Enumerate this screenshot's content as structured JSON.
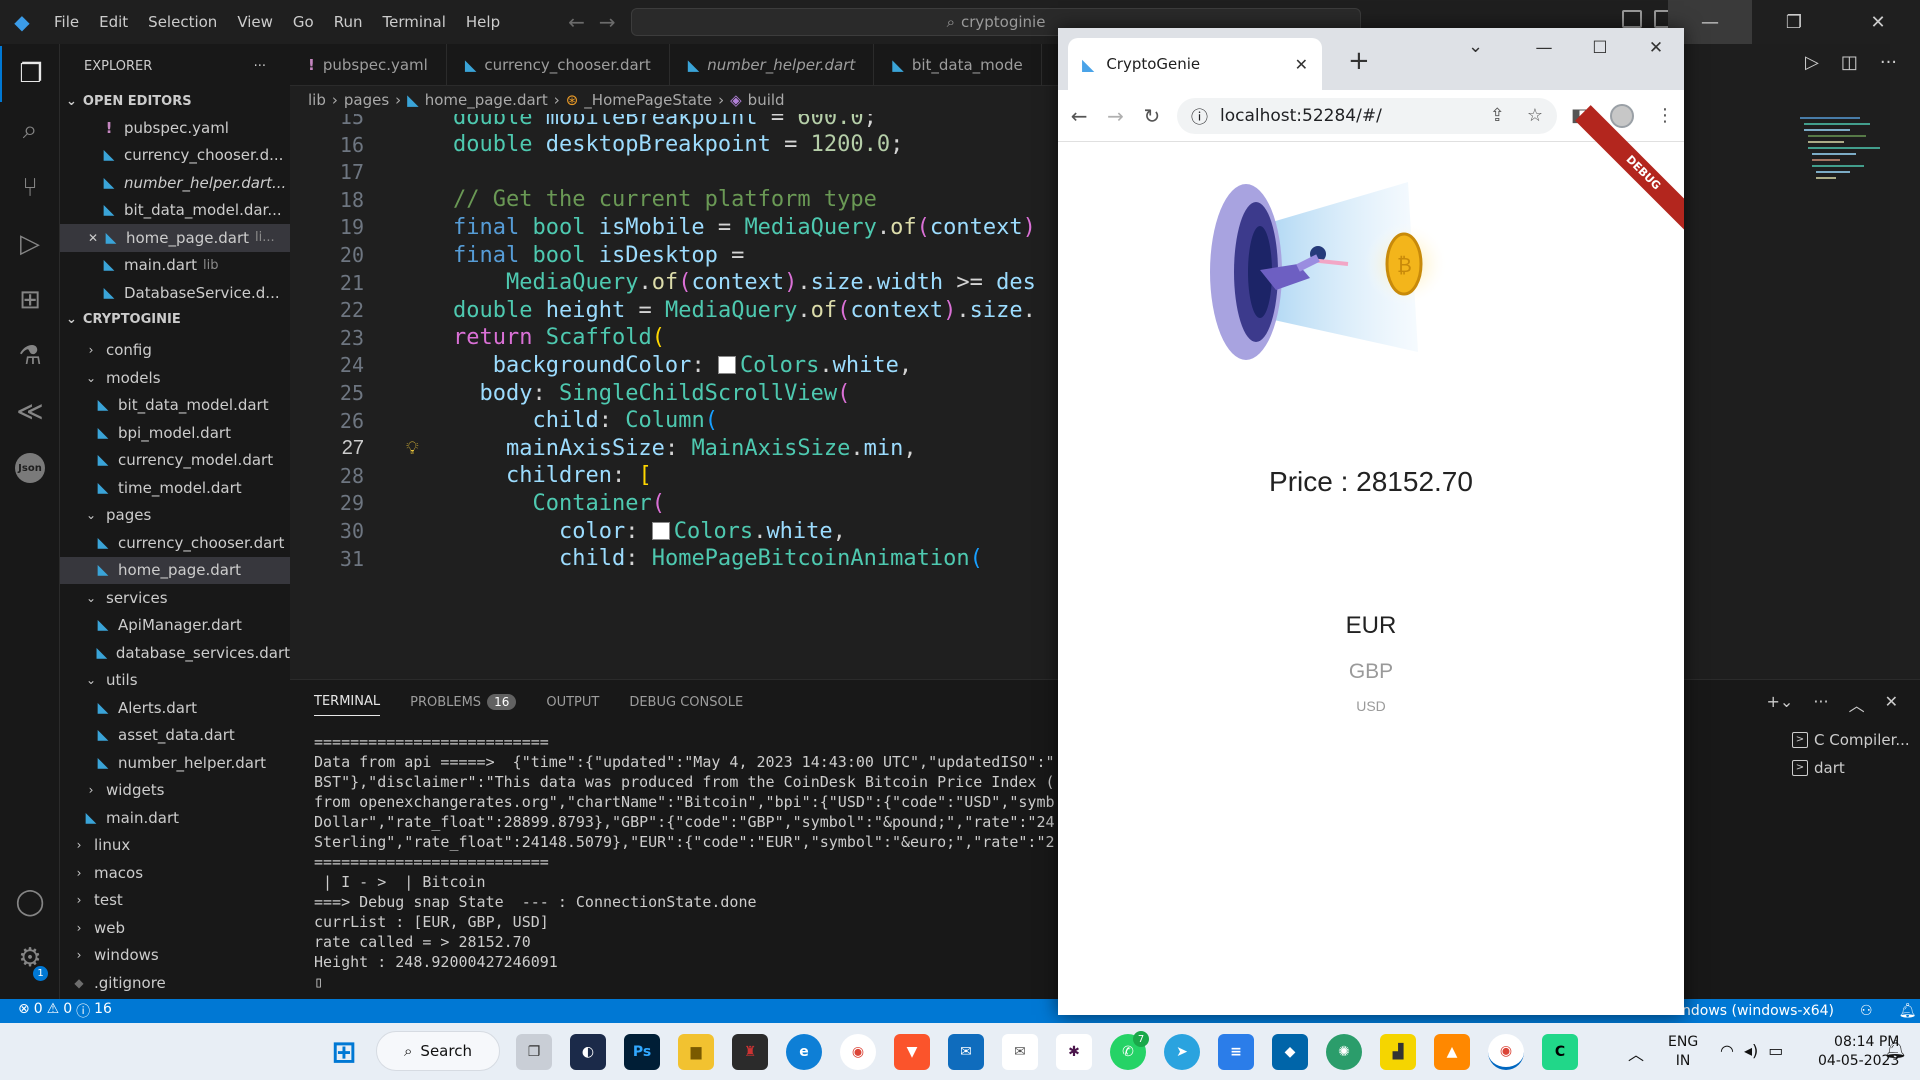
{
  "window": {
    "menu": [
      "File",
      "Edit",
      "Selection",
      "View",
      "Go",
      "Run",
      "Terminal",
      "Help"
    ],
    "search_text": "cryptoginie"
  },
  "sidebar": {
    "header": "EXPLORER",
    "more": "···",
    "open_editors_title": "OPEN EDITORS",
    "open_editors": [
      {
        "name": "pubspec.yaml",
        "kind": "yaml",
        "extra": ""
      },
      {
        "name": "currency_chooser.d...",
        "kind": "dart",
        "extra": ""
      },
      {
        "name": "number_helper.dart...",
        "kind": "dart",
        "extra": ""
      },
      {
        "name": "bit_data_model.dar...",
        "kind": "dart",
        "extra": ""
      },
      {
        "name": "home_page.dart",
        "kind": "dart",
        "extra": "li..."
      },
      {
        "name": "main.dart",
        "kind": "dart",
        "extra": "lib"
      },
      {
        "name": "DatabaseService.d...",
        "kind": "dart",
        "extra": ""
      }
    ],
    "project_title": "CRYPTOGINIE",
    "tree": [
      {
        "label": "config",
        "type": "folder",
        "open": false,
        "depth": 1
      },
      {
        "label": "models",
        "type": "folder",
        "open": true,
        "depth": 1
      },
      {
        "label": "bit_data_model.dart",
        "type": "file",
        "depth": 2
      },
      {
        "label": "bpi_model.dart",
        "type": "file",
        "depth": 2
      },
      {
        "label": "currency_model.dart",
        "type": "file",
        "depth": 2
      },
      {
        "label": "time_model.dart",
        "type": "file",
        "depth": 2
      },
      {
        "label": "pages",
        "type": "folder",
        "open": true,
        "depth": 1
      },
      {
        "label": "currency_chooser.dart",
        "type": "file",
        "depth": 2
      },
      {
        "label": "home_page.dart",
        "type": "file",
        "depth": 2,
        "selected": true
      },
      {
        "label": "services",
        "type": "folder",
        "open": true,
        "depth": 1
      },
      {
        "label": "ApiManager.dart",
        "type": "file",
        "depth": 2
      },
      {
        "label": "database_services.dart",
        "type": "file",
        "depth": 2
      },
      {
        "label": "utils",
        "type": "folder",
        "open": true,
        "depth": 1
      },
      {
        "label": "Alerts.dart",
        "type": "file",
        "depth": 2
      },
      {
        "label": "asset_data.dart",
        "type": "file",
        "depth": 2
      },
      {
        "label": "number_helper.dart",
        "type": "file",
        "depth": 2
      },
      {
        "label": "widgets",
        "type": "folder",
        "open": false,
        "depth": 1
      },
      {
        "label": "main.dart",
        "type": "file",
        "depth": 1
      },
      {
        "label": "linux",
        "type": "folder",
        "open": false,
        "depth": 0
      },
      {
        "label": "macos",
        "type": "folder",
        "open": false,
        "depth": 0
      },
      {
        "label": "test",
        "type": "folder",
        "open": false,
        "depth": 0
      },
      {
        "label": "web",
        "type": "folder",
        "open": false,
        "depth": 0
      },
      {
        "label": "windows",
        "type": "folder",
        "open": false,
        "depth": 0
      },
      {
        "label": ".gitignore",
        "type": "file",
        "depth": 0
      }
    ]
  },
  "tabs": [
    {
      "label": "pubspec.yaml",
      "kind": "yaml",
      "italic": false
    },
    {
      "label": "currency_chooser.dart",
      "kind": "dart",
      "italic": false
    },
    {
      "label": "number_helper.dart",
      "kind": "dart",
      "italic": true
    },
    {
      "label": "bit_data_mode",
      "kind": "dart",
      "italic": false
    }
  ],
  "breadcrumb": [
    "lib",
    "pages",
    "home_page.dart",
    "_HomePageState",
    "build"
  ],
  "code": {
    "current_line": 27,
    "lines": [
      {
        "n": 15,
        "html": "<span class='ty2'>double</span> <span class='vr'>mobileBreakpoint</span> = <span class='nm'>600.0</span>;"
      },
      {
        "n": 16,
        "html": "<span class='ty2'>double</span> <span class='vr'>desktopBreakpoint</span> = <span class='nm'>1200.0</span>;"
      },
      {
        "n": 17,
        "html": ""
      },
      {
        "n": 18,
        "html": "<span class='cm'>// Get the current platform type</span>"
      },
      {
        "n": 19,
        "html": "<span class='kw'>final</span> <span class='ty2'>bool</span> <span class='vr'>isMobile</span> = <span class='ty2'>MediaQuery</span>.<span class='fn'>of</span><span class='br2'>(</span><span class='vr'>context</span><span class='br2'>)</span>"
      },
      {
        "n": 20,
        "html": "<span class='kw'>final</span> <span class='ty2'>bool</span> <span class='vr'>isDesktop</span> ="
      },
      {
        "n": 21,
        "html": "    <span class='ty2'>MediaQuery</span>.<span class='fn'>of</span><span class='br2'>(</span><span class='vr'>context</span><span class='br2'>)</span>.<span class='vr'>size</span>.<span class='vr'>width</span> &gt;= <span class='vr'>des</span>"
      },
      {
        "n": 22,
        "html": "<span class='ty2'>double</span> <span class='vr'>height</span> = <span class='ty2'>MediaQuery</span>.<span class='fn'>of</span><span class='br2'>(</span><span class='vr'>context</span><span class='br2'>)</span>.<span class='vr'>size</span>."
      },
      {
        "n": 23,
        "html": "<span class='br2'>return</span> <span class='ty2'>Scaffold</span><span class='br'>(</span>"
      },
      {
        "n": 24,
        "html": "   <span class='vr'>backgroundColor</span>: <span class='swatch'></span><span class='ty2'>Colors</span>.<span class='vr'>white</span>,"
      },
      {
        "n": 25,
        "html": "  <span class='vr'>body</span>: <span class='ty2'>SingleChildScrollView</span><span class='br2'>(</span>"
      },
      {
        "n": 26,
        "html": "      <span class='vr'>child</span>: <span class='ty2'>Column</span><span class='br3'>(</span>"
      },
      {
        "n": 27,
        "html": "    <span class='vr'>mainAxisSize</span>: <span class='ty2'>MainAxisSize</span>.<span class='vr'>min</span>,"
      },
      {
        "n": 28,
        "html": "    <span class='vr'>children</span>: <span class='br'>[</span>"
      },
      {
        "n": 29,
        "html": "      <span class='ty2'>Container</span><span class='br2'>(</span>"
      },
      {
        "n": 30,
        "html": "        <span class='vr'>color</span>: <span class='swatch'></span><span class='ty2'>Colors</span>.<span class='vr'>white</span>,"
      },
      {
        "n": 31,
        "html": "        <span class='vr'>child</span>: <span class='ty2'>HomePageBitcoinAnimation</span><span class='br3'>(</span>"
      }
    ]
  },
  "panel": {
    "tabs": [
      "TERMINAL",
      "PROBLEMS",
      "OUTPUT",
      "DEBUG CONSOLE"
    ],
    "problems_count": "16",
    "terminal_lines": [
      "==========================",
      "Data from api =====>  {\"time\":{\"updated\":\"May 4, 2023 14:43:00 UTC\",\"updatedISO\":\"",
      "BST\"},\"disclaimer\":\"This data was produced from the CoinDesk Bitcoin Price Index (",
      "from openexchangerates.org\",\"chartName\":\"Bitcoin\",\"bpi\":{\"USD\":{\"code\":\"USD\",\"symb",
      "Dollar\",\"rate_float\":28899.8793},\"GBP\":{\"code\":\"GBP\",\"symbol\":\"&pound;\",\"rate\":\"24",
      "Sterling\",\"rate_float\":24148.5079},\"EUR\":{\"code\":\"EUR\",\"symbol\":\"&euro;\",\"rate\":\"2",
      "==========================",
      " | I - >  | Bitcoin",
      "===> Debug snap State  --- : ConnectionState.done",
      "currList : [EUR, GBP, USD]",
      "rate called = > 28152.70",
      "Height : 248.92000427246091",
      "▯"
    ],
    "terminal_list": [
      "C Compiler...",
      "dart"
    ]
  },
  "statusbar": {
    "errors": "0",
    "warnings": "0",
    "info": "16",
    "right_text": "ndows (windows-x64)"
  },
  "browser": {
    "tab_title": "CryptoGenie",
    "url": "localhost:52284/#/",
    "debug_banner": "DEBUG",
    "price_label": "Price : 28152.70",
    "currencies": [
      "EUR",
      "GBP",
      "USD"
    ]
  },
  "taskbar": {
    "search_label": "Search",
    "lang_top": "ENG",
    "lang_bottom": "IN",
    "time": "08:14 PM",
    "date": "04-05-2023",
    "whatsapp_badge": "7"
  }
}
